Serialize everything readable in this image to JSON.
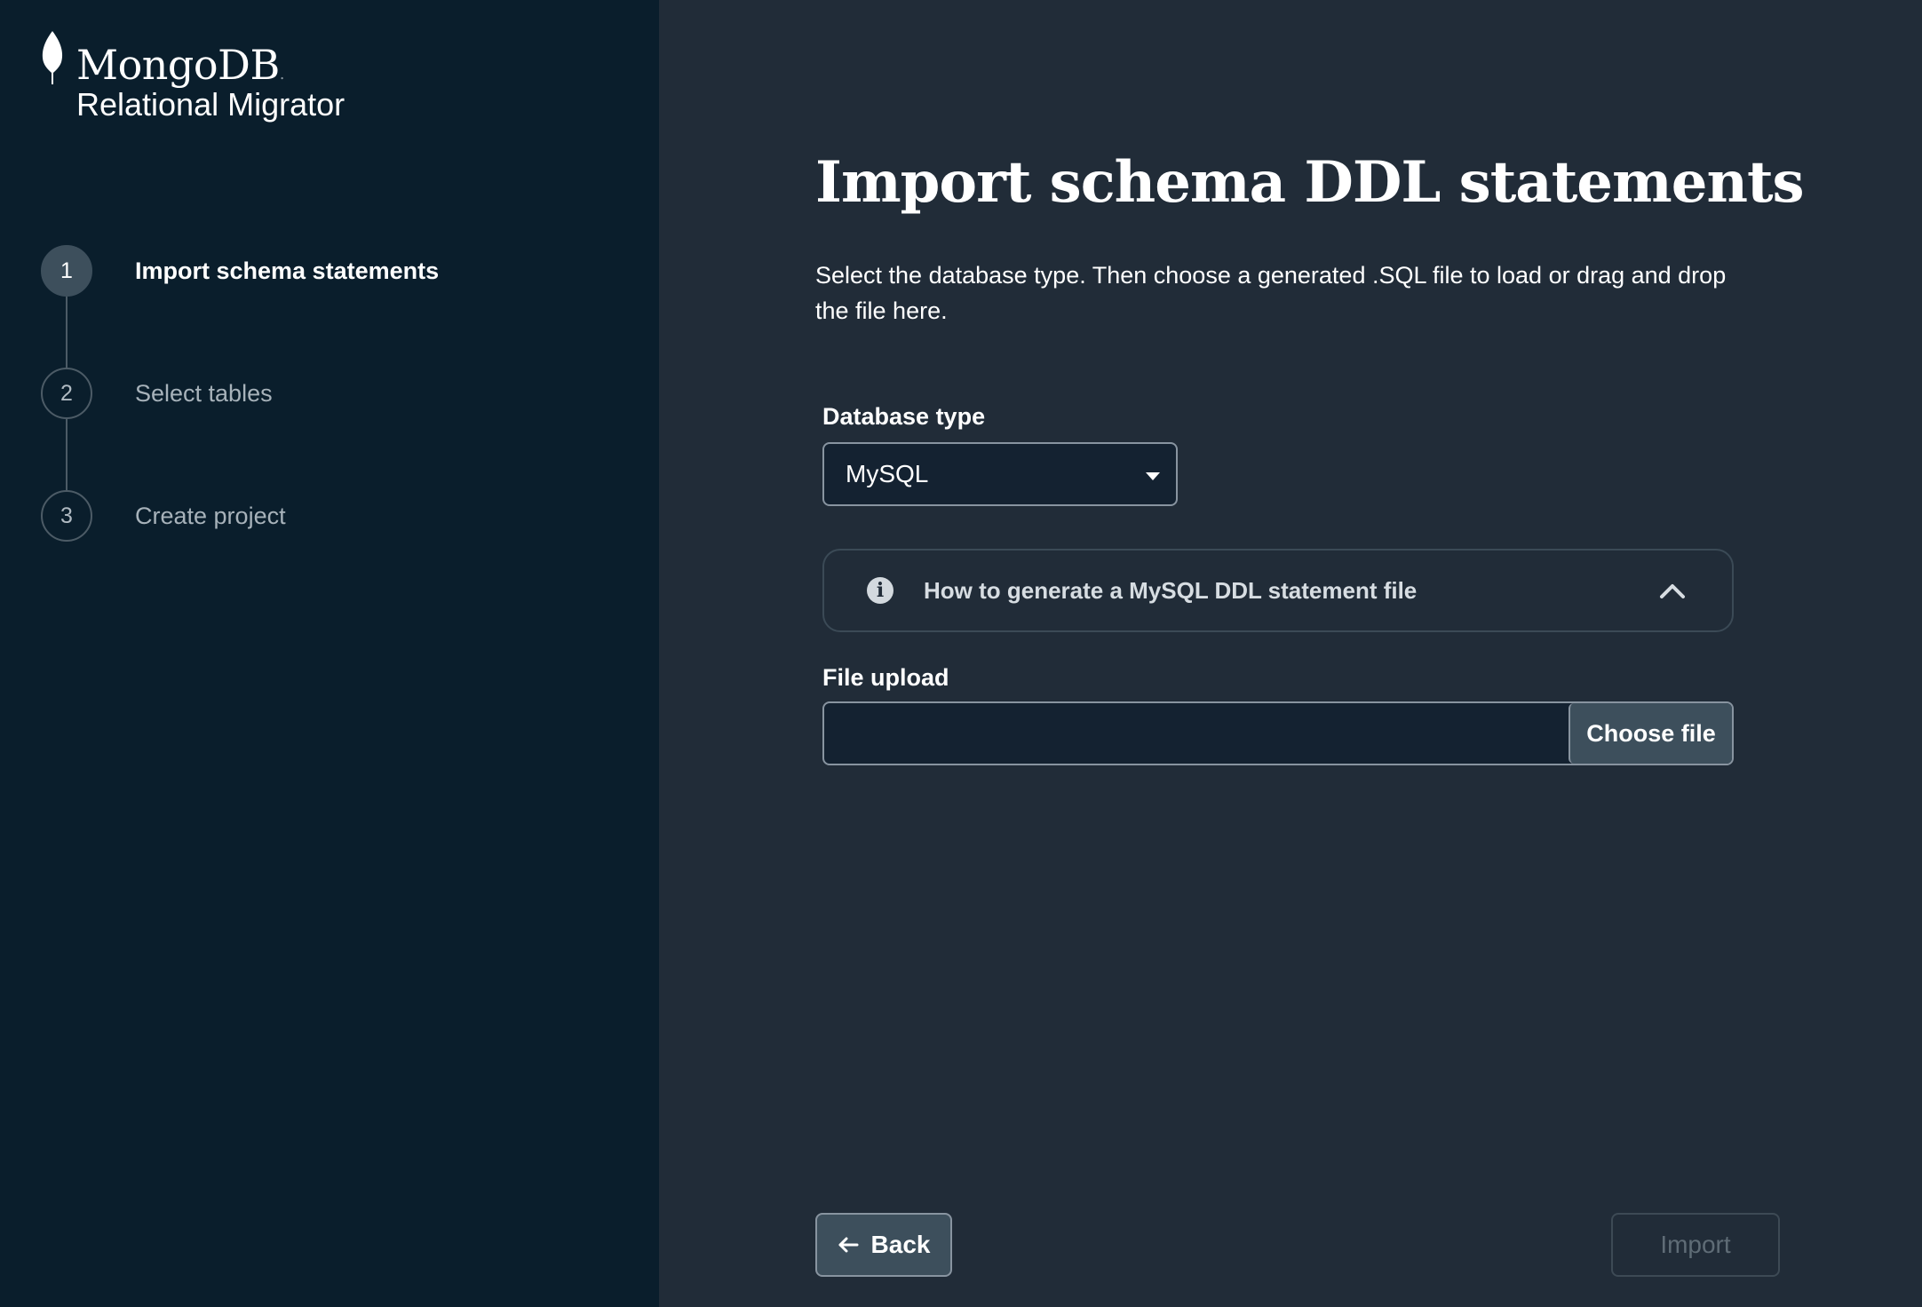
{
  "brand": {
    "name": "MongoDB",
    "mark": ".",
    "product": "Relational Migrator"
  },
  "steps": [
    {
      "number": "1",
      "label": "Import schema statements",
      "active": true
    },
    {
      "number": "2",
      "label": "Select tables",
      "active": false
    },
    {
      "number": "3",
      "label": "Create project",
      "active": false
    }
  ],
  "main": {
    "title": "Import schema DDL statements",
    "description": "Select the database type. Then choose a generated .SQL file to load or drag and drop the file here.",
    "database_type": {
      "label": "Database type",
      "selected": "MySQL"
    },
    "info": {
      "icon": "info-icon",
      "text": "How to generate a MySQL DDL statement file",
      "expand_icon": "chevron-up-icon"
    },
    "file_upload": {
      "label": "File upload",
      "value": "",
      "button_label": "Choose file"
    }
  },
  "footer": {
    "back_label": "Back",
    "import_label": "Import"
  },
  "colors": {
    "sidebar_bg": "#0a1e2c",
    "main_bg": "#212c38",
    "button_bg": "#3d4f5c",
    "border": "#8894a0"
  }
}
